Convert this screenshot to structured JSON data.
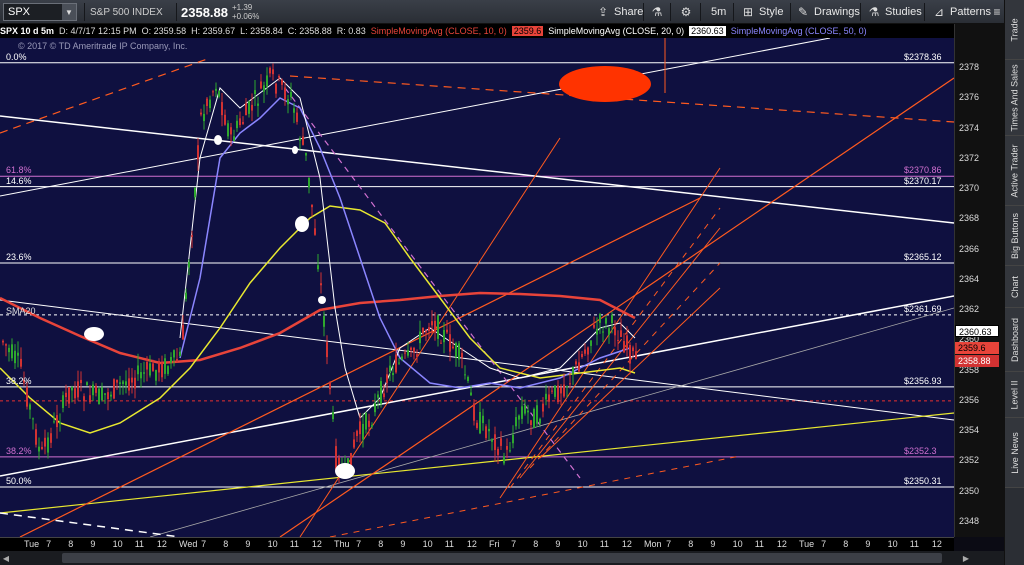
{
  "toolbar": {
    "symbol": "SPX",
    "description": "S&P 500 INDEX",
    "last_price": "2358.88",
    "change_abs": "+1.39",
    "change_pct": "+0.06%",
    "share": "Share",
    "timeframe": "5m",
    "style": "Style",
    "drawings": "Drawings",
    "studies": "Studies",
    "patterns": "Patterns"
  },
  "infobar": {
    "title": "SPX 10 d 5m",
    "datetime": "D: 4/7/17 12:15 PM",
    "open": "O: 2359.58",
    "high": "H: 2359.67",
    "low": "L: 2358.84",
    "close": "C: 2358.88",
    "range": "R: 0.83",
    "sma10_label": "SimpleMovingAvg (CLOSE, 10, 0)",
    "sma10_value": "2359.6",
    "sma20_label": "SimpleMovingAvg (CLOSE, 20, 0)",
    "sma20_value": "2360.63",
    "sma50_label": "SimpleMovingAvg (CLOSE, 50, 0)"
  },
  "watermark": "© 2017 © TD Ameritrade IP Company, Inc.",
  "y_axis": {
    "ticks": [
      "2378",
      "2376",
      "2374",
      "2372",
      "2370",
      "2368",
      "2366",
      "2364",
      "2362",
      "2360",
      "2358",
      "2356",
      "2354",
      "2352",
      "2350",
      "2348"
    ],
    "badges": {
      "sma20": "2360.63",
      "sma10": "2359.6",
      "last": "2358.88"
    }
  },
  "x_axis": {
    "ticks": [
      "Tue",
      "7",
      "8",
      "9",
      "10",
      "11",
      "12",
      "Wed",
      "7",
      "8",
      "9",
      "10",
      "11",
      "12",
      "Thu",
      "7",
      "8",
      "9",
      "10",
      "11",
      "12",
      "Fri",
      "7",
      "8",
      "9",
      "10",
      "11",
      "12",
      "Mon",
      "7",
      "8",
      "9",
      "10",
      "11",
      "12",
      "Tue",
      "7",
      "8",
      "9",
      "10",
      "11",
      "12"
    ]
  },
  "fib_levels": [
    {
      "pct": "0.0%",
      "price": "$2378.36",
      "value": 2378.36,
      "color": "#ffffff"
    },
    {
      "pct": "61.8%",
      "price": "$2370.86",
      "value": 2370.86,
      "color": "#d070d0"
    },
    {
      "pct": "14.6%",
      "price": "$2370.17",
      "value": 2370.17,
      "color": "#ffffff"
    },
    {
      "pct": "23.6%",
      "price": "$2365.12",
      "value": 2365.12,
      "color": "#ffffff"
    },
    {
      "pct": "",
      "price": "$2361.69",
      "value": 2361.69,
      "color": "#ffffff"
    },
    {
      "pct": "38.2%",
      "price": "$2356.93",
      "value": 2356.93,
      "color": "#ffffff"
    },
    {
      "pct": "38.2%",
      "price": "$2352.3",
      "value": 2352.3,
      "color": "#d070d0"
    },
    {
      "pct": "50.0%",
      "price": "$2350.31",
      "value": 2350.31,
      "color": "#ffffff"
    }
  ],
  "top_fib_pct": "0.0%",
  "sma_label": "SMA20",
  "side_tabs": [
    "Trade",
    "Times And Sales",
    "Active Trader",
    "Big Buttons",
    "Chart",
    "Dashboard",
    "Level II",
    "Live News"
  ],
  "colors": {
    "background": "#0f1040",
    "sma10": "#e8443a",
    "sma20": "#ffffff",
    "sma50": "#8b86ff",
    "trend_red": "#ff5a1f",
    "trend_yellow": "#e8e830",
    "candle_up": "#2ea82e",
    "candle_down": "#d23232"
  },
  "chart_data": {
    "type": "candlestick",
    "ylim": [
      2347,
      2380
    ],
    "notes": "10 day 5-minute SPX chart with moving averages and drawn trendlines"
  }
}
